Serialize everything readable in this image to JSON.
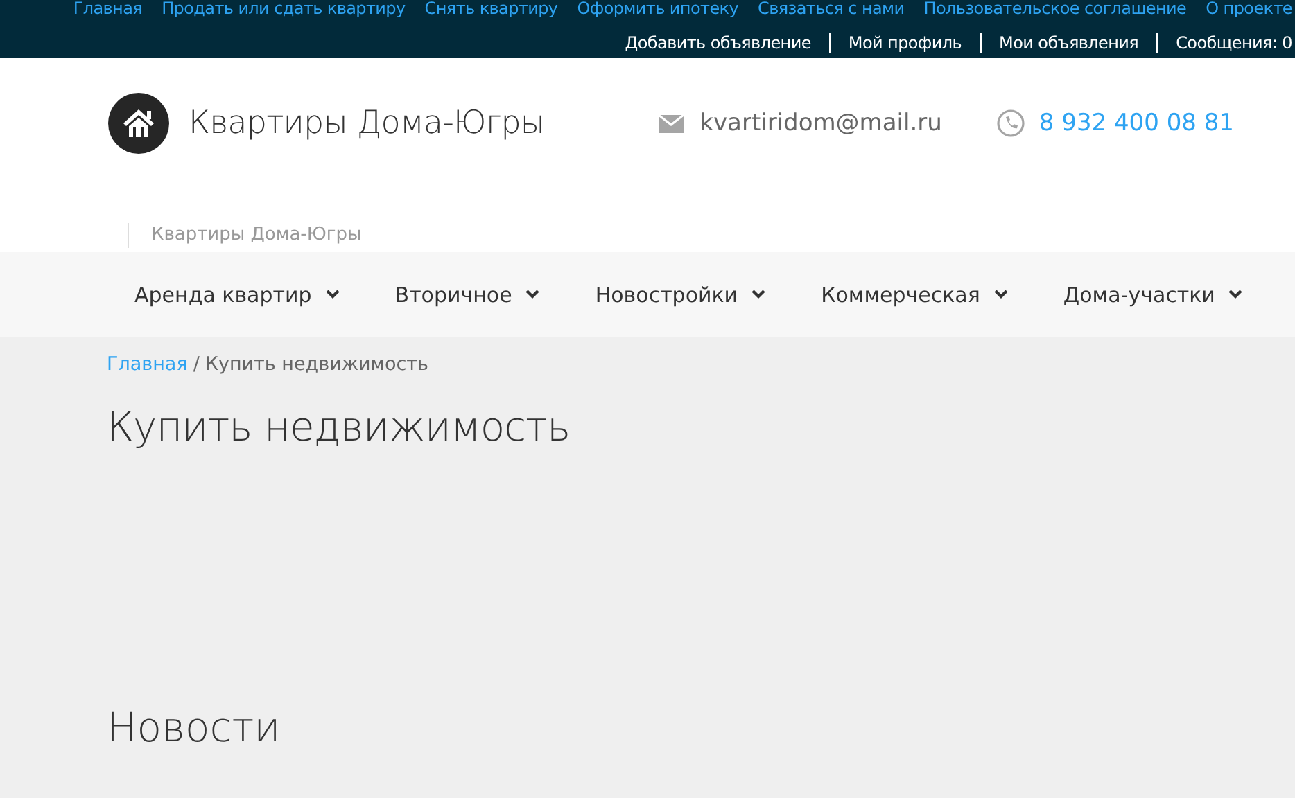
{
  "top_links": [
    "Главная",
    "Продать или сдать квартиру",
    "Снять квартиру",
    "Оформить ипотеку",
    "Связаться с нами",
    "Пользовательское соглашение",
    "О проекте"
  ],
  "user_links": [
    "Добавить объявление",
    "Мой профиль",
    "Мои объявления",
    "Сообщения: 0"
  ],
  "site_title": "Квартиры Дома-Югры",
  "email": "kvartiridom@mail.ru",
  "phone": "8 932 400 08 81",
  "tagline": "Квартиры Дома-Югры",
  "nav": [
    "Аренда квартир",
    "Вторичное",
    "Новостройки",
    "Коммерческая",
    "Дома-участки"
  ],
  "breadcrumb": {
    "home": "Главная",
    "separator": "/",
    "current": "Купить недвижимость"
  },
  "page_title": "Купить недвижимость",
  "section_title": "Новости"
}
